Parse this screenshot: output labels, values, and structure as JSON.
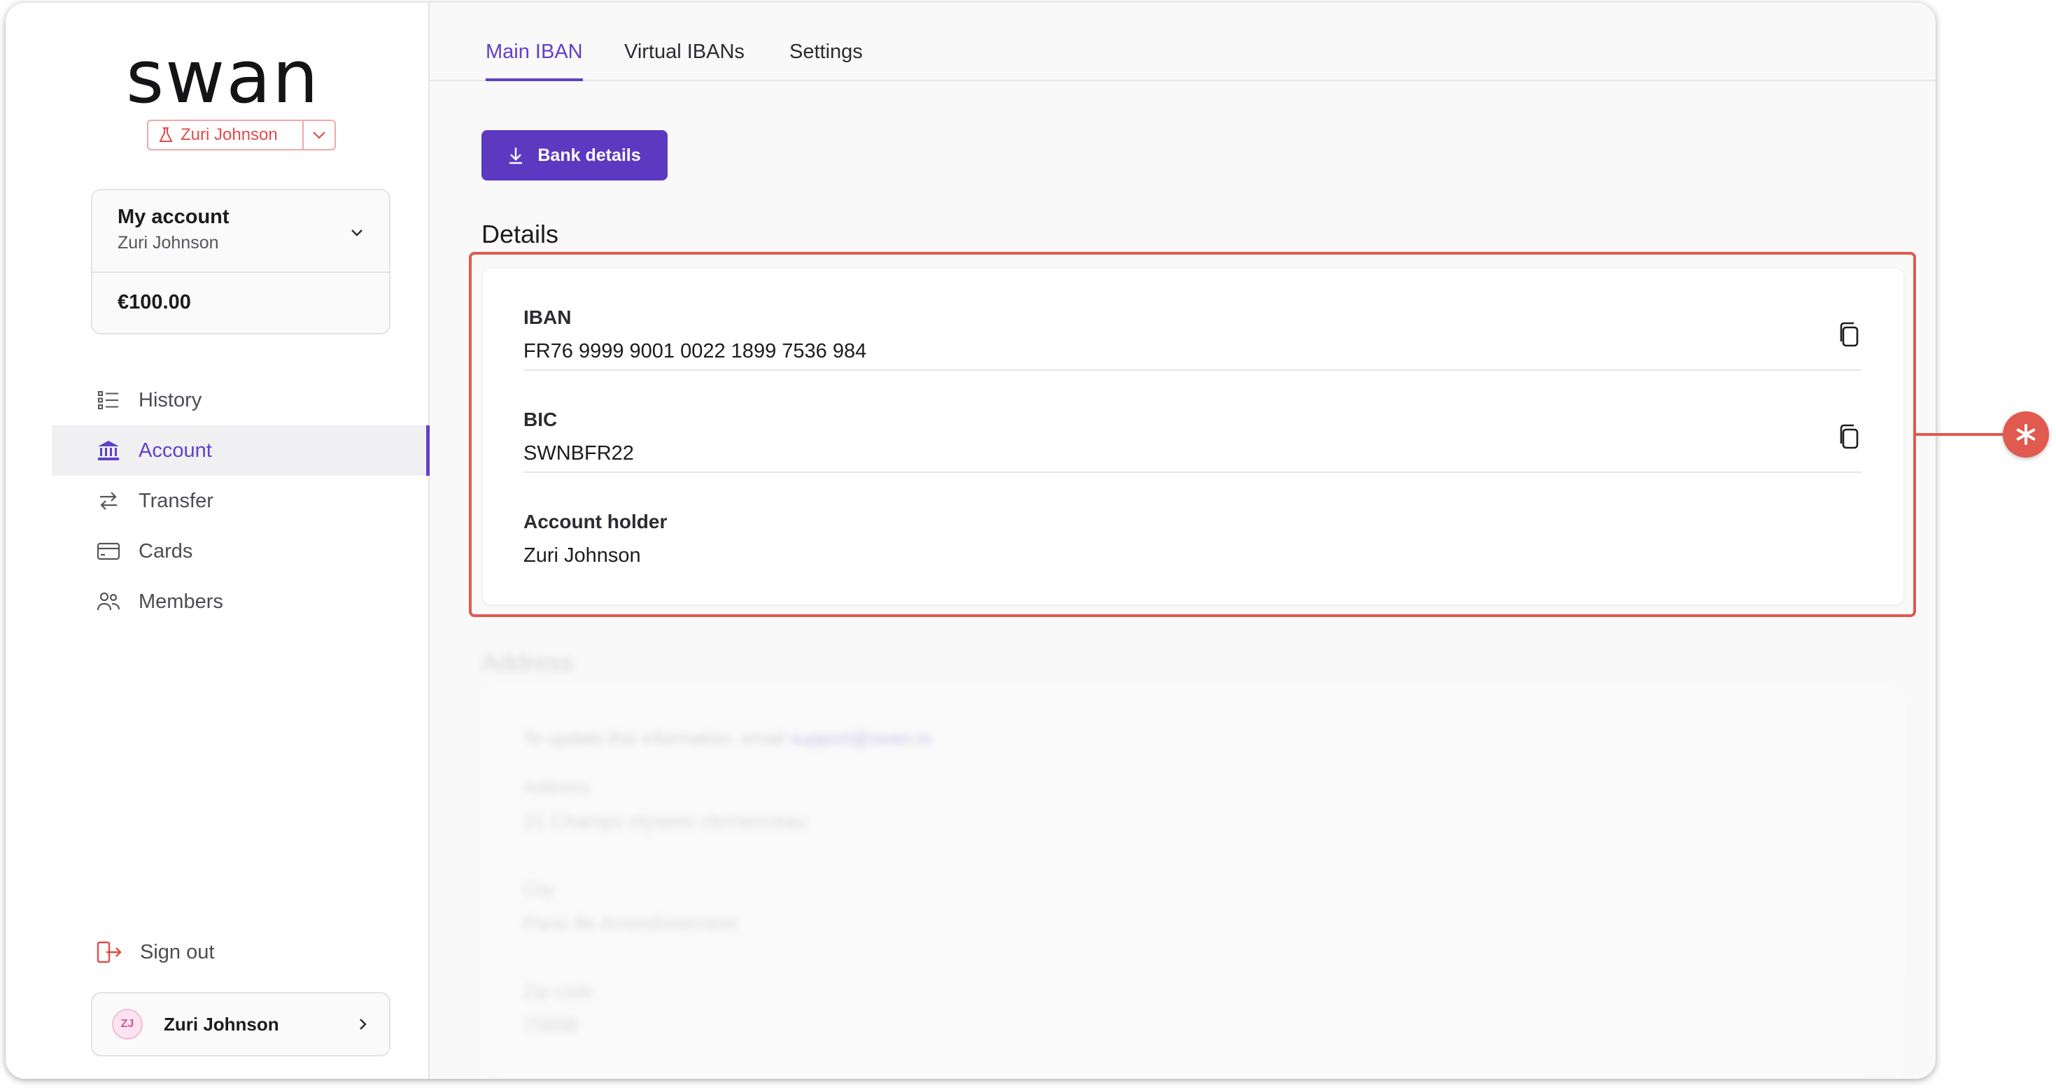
{
  "brand": {
    "logo_text": "swan"
  },
  "project_switch": {
    "name": "Zuri Johnson"
  },
  "account_card": {
    "title": "My account",
    "holder": "Zuri Johnson",
    "balance": "€100.00"
  },
  "nav": {
    "items": [
      {
        "label": "History",
        "icon": "history-list-icon"
      },
      {
        "label": "Account",
        "icon": "bank-icon",
        "active": true
      },
      {
        "label": "Transfer",
        "icon": "transfer-arrows-icon"
      },
      {
        "label": "Cards",
        "icon": "card-icon"
      },
      {
        "label": "Members",
        "icon": "members-icon"
      }
    ]
  },
  "footer": {
    "signout_label": "Sign out",
    "user_initials": "ZJ",
    "user_name": "Zuri Johnson"
  },
  "tabs": [
    {
      "label": "Main IBAN",
      "active": true
    },
    {
      "label": "Virtual IBANs"
    },
    {
      "label": "Settings"
    }
  ],
  "bank_details_button": {
    "label": "Bank details"
  },
  "details": {
    "title": "Details",
    "rows": [
      {
        "label": "IBAN",
        "value": "FR76 9999 9001 0022 1899 7536 984",
        "copyable": true
      },
      {
        "label": "BIC",
        "value": "SWNBFR22",
        "copyable": true
      },
      {
        "label": "Account holder",
        "value": "Zuri Johnson"
      }
    ]
  },
  "address": {
    "title": "Address",
    "note": "To update this information, email",
    "email": "support@swan.io",
    "fields": [
      {
        "label": "Address",
        "value": "21 Champs elysees clemenceau"
      },
      {
        "label": "City",
        "value": "Paris 8e Arrondissement"
      },
      {
        "label": "Zip code",
        "value": "75008"
      }
    ]
  },
  "colors": {
    "accent": "#6240c7",
    "button": "#5c39c0",
    "highlight": "#e05a4f",
    "sandbox": "#e24b4b"
  }
}
